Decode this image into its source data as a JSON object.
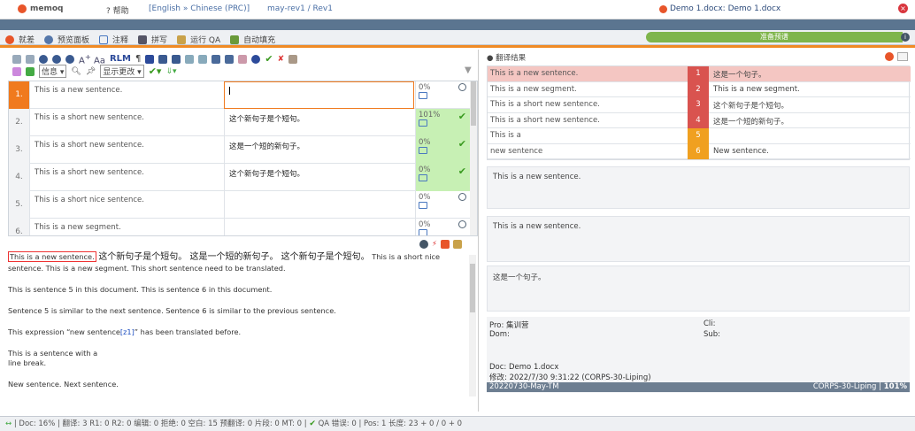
{
  "titlebar": {
    "logo": "memoq",
    "help": "帮助",
    "lang": "[English » Chinese (PRC)]",
    "project": "may-rev1 / Rev1",
    "doc_tab": "Demo 1.docx: Demo 1.docx"
  },
  "ribbon": {
    "items": [
      "就差",
      "预览面板",
      "注释",
      "拼写",
      "运行 QA",
      "自动填充"
    ],
    "pill": "准备预谱"
  },
  "toolbar": {
    "rlm": "RLM",
    "info": "信息",
    "display": "显示更改"
  },
  "grid": {
    "rows": [
      {
        "n": "1.",
        "src": "This is a new sentence.",
        "tgt": "",
        "stat": "0%"
      },
      {
        "n": "2.",
        "src": "This is a short new sentence.",
        "tgt": "这个新句子是个短句。",
        "stat": "101%"
      },
      {
        "n": "3.",
        "src": "This is a short new sentence.",
        "tgt": "这是一个短的新句子。",
        "stat": "0%"
      },
      {
        "n": "4.",
        "src": "This is a short new sentence.",
        "tgt": "这个新句子是个短句。",
        "stat": "0%"
      },
      {
        "n": "5.",
        "src": "This is a short nice sentence.",
        "tgt": "",
        "stat": "0%"
      },
      {
        "n": "6.",
        "src": "This is a new segment.",
        "tgt": "",
        "stat": "0%"
      }
    ]
  },
  "preview": {
    "p1_hl": "This is a new sentence.",
    "p1_big": "这个新句子是个短句。 这是一个短的新句子。 这个新句子是个短句。",
    "p1_rest": "This is a short nice sentence. This is a new segment. This short sentence need to be translated.",
    "p2": "This is sentence 5 in this document. This is sentence 6 in this document.",
    "p3": "Sentence 5 is similar to the next sentence. Sentence 6 is similar to the previous sentence.",
    "p4a": "This expression “new sentence",
    "p4tag": "[z1]",
    "p4b": "” has been translated before.",
    "p5a": "This is a sentence with a",
    "p5b": "line break.",
    "p6": "New sentence. Next sentence."
  },
  "results": {
    "header": "翻译结果",
    "rows": [
      {
        "a": "This is a new sentence.",
        "n": "1",
        "b": "这是一个句子。",
        "color": "#d9534f"
      },
      {
        "a": "This is a new segment.",
        "n": "2",
        "b": "This is a new segment.",
        "color": "#d9534f"
      },
      {
        "a": "This is a short new sentence.",
        "n": "3",
        "b": "这个新句子是个短句。",
        "color": "#d9534f"
      },
      {
        "a": "This is a short new sentence.",
        "n": "4",
        "b": "这是一个短的新句子。",
        "color": "#d9534f"
      },
      {
        "a": "This is a",
        "n": "5",
        "b": "",
        "color": "#f0a020"
      },
      {
        "a": "new sentence",
        "n": "6",
        "b": "New sentence.",
        "color": "#f0a020"
      }
    ]
  },
  "boxes": {
    "b1": "This is a new sentence.",
    "b2": "This is a new sentence.",
    "b3": "这是一个句子。"
  },
  "meta": {
    "pro": "Pro: 集训营",
    "cli": "Cli:",
    "dom": "Dom:",
    "sub": "Sub:",
    "doc": "Doc:  Demo 1.docx",
    "mod": "修改:  2022/7/30 9:31:22 (CORPS-30-Liping)",
    "bar_left": "20220730-May-TM",
    "bar_right": "CORPS-30-Liping",
    "bar_pct": "101%"
  },
  "status": {
    "text": "Doc: 16% | 翻译: 3 R1: 0 R2: 0 编辑: 0 拒绝: 0 空白: 15 预翻译: 0 片段: 0 MT: 0 |",
    "qa": "QA 错误: 0 | Pos: 1 长度: 23 + 0 / 0 + 0"
  }
}
